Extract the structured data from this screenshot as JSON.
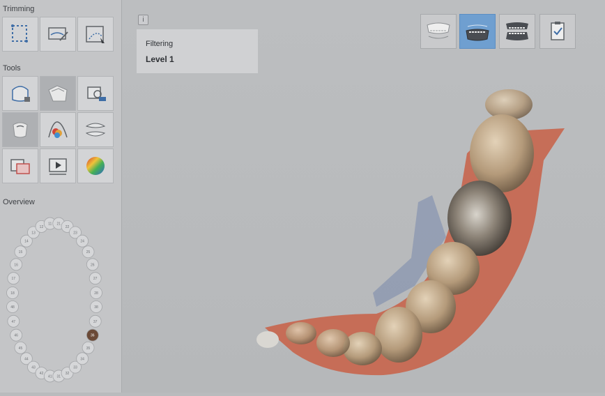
{
  "sidebar": {
    "trimming_title": "Trimming",
    "tools_title": "Tools",
    "overview_title": "Overview",
    "trimming_tools": [
      {
        "icon": "trim-select-icon"
      },
      {
        "icon": "trim-plane-icon"
      },
      {
        "icon": "trim-brush-icon"
      }
    ],
    "tools": [
      {
        "icon": "margin-lock-icon"
      },
      {
        "icon": "mesh-fill-icon",
        "active": true
      },
      {
        "icon": "screenshot-icon"
      },
      {
        "icon": "tooth-icon",
        "active": true
      },
      {
        "icon": "color-analysis-icon"
      },
      {
        "icon": "occlusion-icon"
      },
      {
        "icon": "compare-icon"
      },
      {
        "icon": "play-video-icon"
      },
      {
        "icon": "deviation-map-icon"
      }
    ],
    "overview": {
      "tooth_numbers_upper": [
        "18",
        "17",
        "16",
        "15",
        "14",
        "13",
        "12",
        "11",
        "21",
        "22",
        "23",
        "24",
        "25",
        "26",
        "27",
        "28"
      ],
      "tooth_numbers_lower": [
        "48",
        "47",
        "46",
        "45",
        "44",
        "43",
        "42",
        "41",
        "31",
        "32",
        "33",
        "34",
        "35",
        "36",
        "37",
        "38"
      ],
      "selected_tooth": "36"
    }
  },
  "viewport": {
    "info_symbol": "i",
    "filter_label": "Filtering",
    "filter_value": "Level 1",
    "view_modes": [
      {
        "icon": "upper-jaw-view-icon"
      },
      {
        "icon": "lower-jaw-view-icon",
        "active": true
      },
      {
        "icon": "occlusion-view-icon"
      },
      {
        "icon": "checklist-icon"
      }
    ]
  },
  "colors": {
    "accent": "#6f9fd0",
    "gum": "#c8654d",
    "tooth": "#b49a7a"
  }
}
